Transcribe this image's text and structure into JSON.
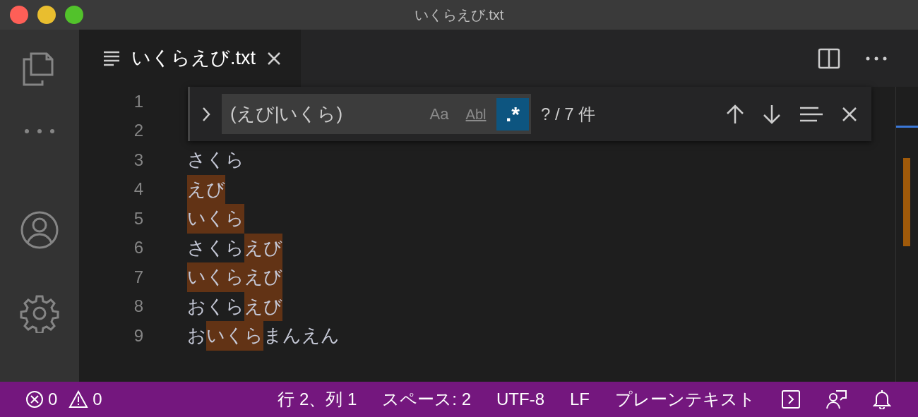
{
  "window": {
    "title": "いくらえび.txt"
  },
  "tabs": [
    {
      "label": "いくらえび.txt",
      "selected": true
    }
  ],
  "find_widget": {
    "value": "(えび|いくら)",
    "expanded": false,
    "result": "? / 7 件",
    "options": [
      {
        "label": "Aa",
        "kind": "match_case",
        "on": false
      },
      {
        "label": "Abl",
        "kind": "whole_word",
        "on": false
      },
      {
        "label": ".*",
        "kind": "regex",
        "on": true
      }
    ]
  },
  "editor": {
    "lines": [
      {
        "number": "1"
      },
      {
        "number": "2"
      },
      {
        "number": "3",
        "segments": [
          {
            "text": "さくら",
            "match": false
          }
        ]
      },
      {
        "number": "4",
        "segments": [
          {
            "text": "えび",
            "match": true
          }
        ]
      },
      {
        "number": "5",
        "segments": [
          {
            "text": "いくら",
            "match": true
          }
        ]
      },
      {
        "number": "6",
        "segments": [
          {
            "text": "さくら",
            "match": false
          },
          {
            "text": "えび",
            "match": true
          }
        ]
      },
      {
        "number": "7",
        "segments": [
          {
            "text": "いくらえび",
            "match": true
          }
        ]
      },
      {
        "number": "8",
        "segments": [
          {
            "text": "おくら",
            "match": false
          },
          {
            "text": "えび",
            "match": true
          }
        ]
      },
      {
        "number": "9",
        "segments": [
          {
            "text": "お",
            "match": false
          },
          {
            "text": "いくら",
            "match": true
          },
          {
            "text": "まんえん",
            "match": false
          }
        ]
      }
    ]
  },
  "status_bar": {
    "errors": "0",
    "warnings": "0",
    "items": [
      "行 2、列 1",
      "スペース: 2",
      "UTF-8",
      "LF",
      "プレーンテキスト"
    ]
  }
}
